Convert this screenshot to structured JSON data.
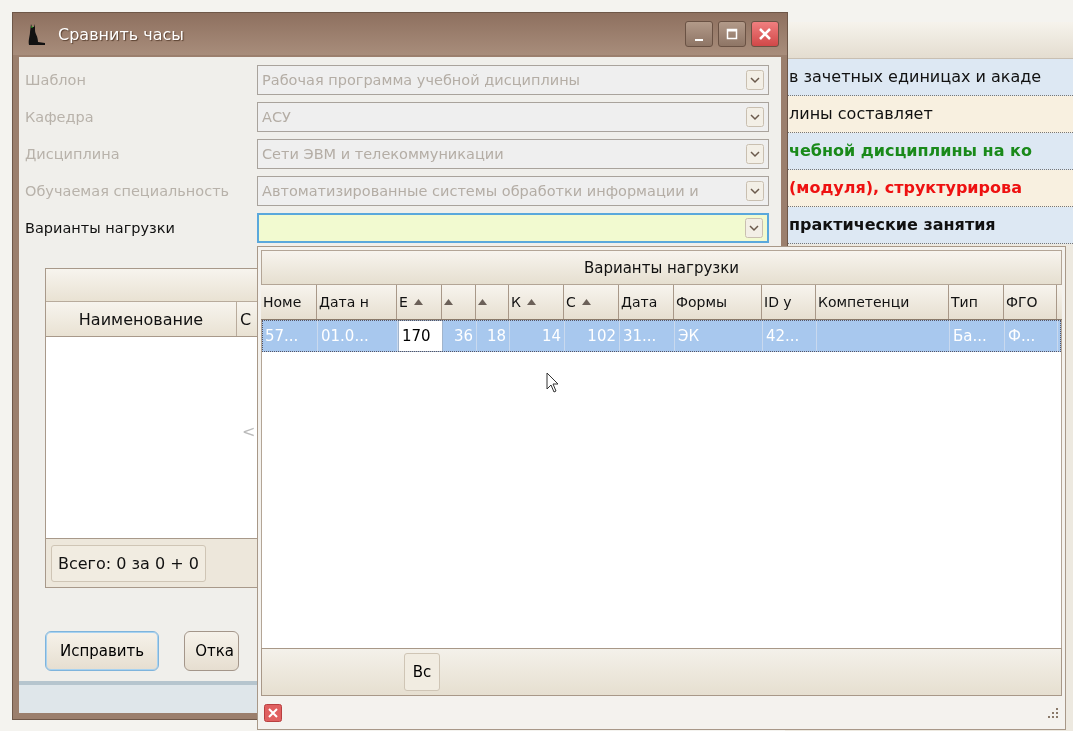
{
  "background_document": {
    "rows": [
      {
        "text": "в зачетных единицах и акаде",
        "kind": "plain"
      },
      {
        "text": "лины составляет",
        "kind": "plain"
      },
      {
        "text": "чебной дисциплины на ко",
        "kind": "highlight"
      },
      {
        "text": "(модуля), структурирова",
        "kind": "warning"
      },
      {
        "text": "практические занятия",
        "kind": "heading"
      }
    ]
  },
  "dialog": {
    "title": "Сравнить часы",
    "fields": [
      {
        "label": "Шаблон",
        "value": "Рабочая программа учебной дисциплины",
        "disabled": true
      },
      {
        "label": "Кафедра",
        "value": "АСУ",
        "disabled": true
      },
      {
        "label": "Дисциплина",
        "value": "Сети ЭВМ и телекоммуникации",
        "disabled": true
      },
      {
        "label": "Обучаемая специальность",
        "value": "Автоматизированные системы обработки информации и",
        "disabled": true
      },
      {
        "label": "Варианты нагрузки",
        "disabled": false
      }
    ],
    "table": {
      "columns": [
        "Наименование",
        "С"
      ],
      "scroll_mark": "<",
      "total": "Всего: 0 за 0 + 0"
    },
    "buttons": [
      {
        "label": "Исправить",
        "default": true
      },
      {
        "label": "Отка",
        "default": false
      }
    ]
  },
  "popup": {
    "title": "Варианты нагрузки",
    "columns": [
      {
        "label": "Номе",
        "sorted": false
      },
      {
        "label": "Дата н",
        "sorted": false
      },
      {
        "label": "Е",
        "sorted": true
      },
      {
        "sorted": true
      },
      {
        "sorted": true
      },
      {
        "label": "К",
        "sorted": true
      },
      {
        "label": "С",
        "sorted": true
      },
      {
        "label": "Дата",
        "sorted": false
      },
      {
        "label": "Формы",
        "sorted": false
      },
      {
        "label": "ID у",
        "sorted": false
      },
      {
        "label": "Компетенци",
        "sorted": false
      },
      {
        "label": "Тип",
        "sorted": false
      },
      {
        "label": "ФГО",
        "sorted": false
      }
    ],
    "rows": [
      {
        "selected": true,
        "cells": [
          {
            "text": "57...",
            "focused": false
          },
          {
            "text": "01.0...",
            "focused": false
          },
          {
            "text": "170",
            "focused": true
          },
          {
            "text": "36",
            "focused": false
          },
          {
            "text": "18",
            "focused": false
          },
          {
            "text": "14",
            "focused": false
          },
          {
            "text": "102",
            "focused": false
          },
          {
            "text": "31...",
            "focused": false
          },
          {
            "text": "ЭК",
            "focused": false
          },
          {
            "text": "42...",
            "focused": false
          },
          {
            "focused": false
          },
          {
            "text": "Ба...",
            "focused": false
          },
          {
            "text": "Ф...",
            "focused": false
          }
        ]
      }
    ],
    "footer_button": "Вс"
  }
}
